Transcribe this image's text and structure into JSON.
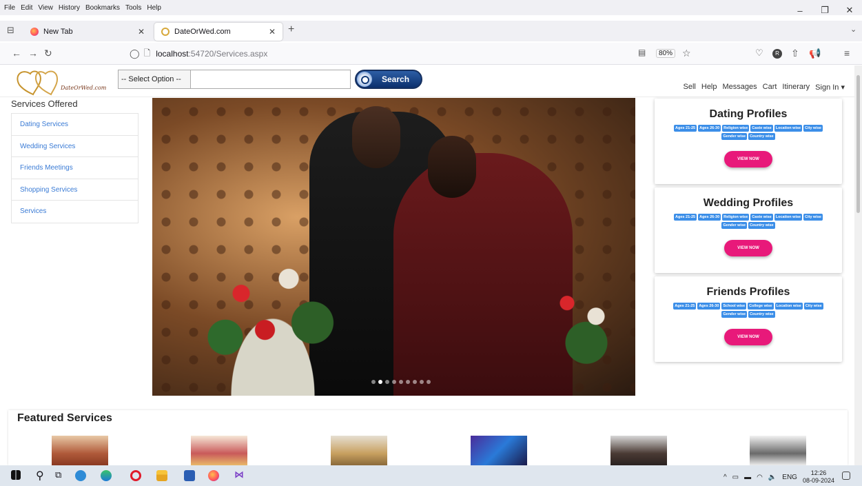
{
  "browser": {
    "menu": [
      "File",
      "Edit",
      "View",
      "History",
      "Bookmarks",
      "Tools",
      "Help"
    ],
    "tabs": [
      {
        "label": "New Tab",
        "active": false
      },
      {
        "label": "DateOrWed.com",
        "active": true
      }
    ],
    "url_host": "localhost",
    "url_path": ":54720/Services.aspx",
    "zoom": "80%"
  },
  "header": {
    "logo_text": "DateOrWed.com",
    "select_value": "-- Select Option --",
    "search_label": "Search",
    "links": [
      "Sell",
      "Help",
      "Messages",
      "Cart",
      "Itinerary",
      "Sign In ▾"
    ]
  },
  "services": {
    "title": "Services Offered",
    "items": [
      "Dating Services",
      "Wedding Services",
      "Friends Meetings",
      "Shopping Services",
      "Services"
    ]
  },
  "carousel": {
    "slide_count": 9,
    "active_index": 1
  },
  "cards": [
    {
      "title": "Dating Profiles",
      "tags": [
        "Ages 21-25",
        "Ages 26-30",
        "Religion wise",
        "Caste wise",
        "Location wise",
        "City wise",
        "Gender wise",
        "Country wise"
      ],
      "button": "VIEW NOW"
    },
    {
      "title": "Wedding Profiles",
      "tags": [
        "Ages 21-25",
        "Ages 26-30",
        "Religion wise",
        "Caste wise",
        "Location wise",
        "City wise",
        "Gender wise",
        "Country wise"
      ],
      "button": "VIEW NOW"
    },
    {
      "title": "Friends Profiles",
      "tags": [
        "Ages 21-25",
        "Ages 26-30",
        "School wise",
        "College wise",
        "Location wise",
        "City wise",
        "Gender wise",
        "Country wise"
      ],
      "button": "VIEW NOW"
    }
  ],
  "featured": {
    "title": "Featured Services",
    "thumbs": [
      "palace-thumb",
      "wedding-decor-thumb",
      "food-thumb",
      "party-thumb",
      "photographer-thumb",
      "couple-thumb"
    ]
  },
  "taskbar": {
    "lang": "ENG",
    "time": "12:26",
    "date": "08-09-2024"
  },
  "colors": {
    "accent_blue": "#3b8ee8",
    "button_pink": "#e8197a",
    "search_button": "#1b4688"
  }
}
